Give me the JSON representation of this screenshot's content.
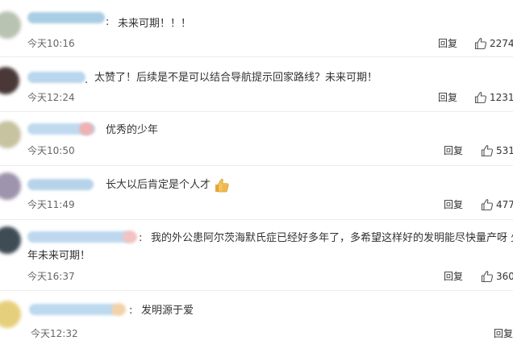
{
  "comments": [
    {
      "text": "未来可期！！！",
      "time": "今天10:16",
      "reply_label": "回复",
      "likes": "2274",
      "avatar_color": "#b9c3b1",
      "name_color": "#a9cde4"
    },
    {
      "text": "太赞了！后续是不是可以结合导航提示回家路线？未来可期！",
      "time": "今天12:24",
      "reply_label": "回复",
      "likes": "1231",
      "avatar_color": "#4a3838",
      "name_color": "#b9d6ec"
    },
    {
      "text": "优秀的少年",
      "time": "今天10:50",
      "reply_label": "回复",
      "likes": "531",
      "avatar_color": "#c7c3a1",
      "name_color": "#bfd9ef"
    },
    {
      "text": "长大以后肯定是个人才",
      "emoji": "thumbs-up-emoji",
      "time": "今天11:49",
      "reply_label": "回复",
      "likes": "477",
      "avatar_color": "#9e94ad",
      "name_color": "#b7d3ea"
    },
    {
      "text_line1": "我的外公患阿尔茨海默氏症已经好多年了，多希望这样好的发明能尽快量产呀 少",
      "text_line2": "年未来可期！",
      "time": "今天16:37",
      "reply_label": "回复",
      "likes": "360",
      "avatar_color": "#3e4c55",
      "name_color": "#bdd8ee"
    },
    {
      "text": "发明源于爱",
      "time": "今天12:32",
      "reply_label": "回复",
      "avatar_color": "#e6cf7c",
      "name_color": "#bdd9ee"
    }
  ]
}
